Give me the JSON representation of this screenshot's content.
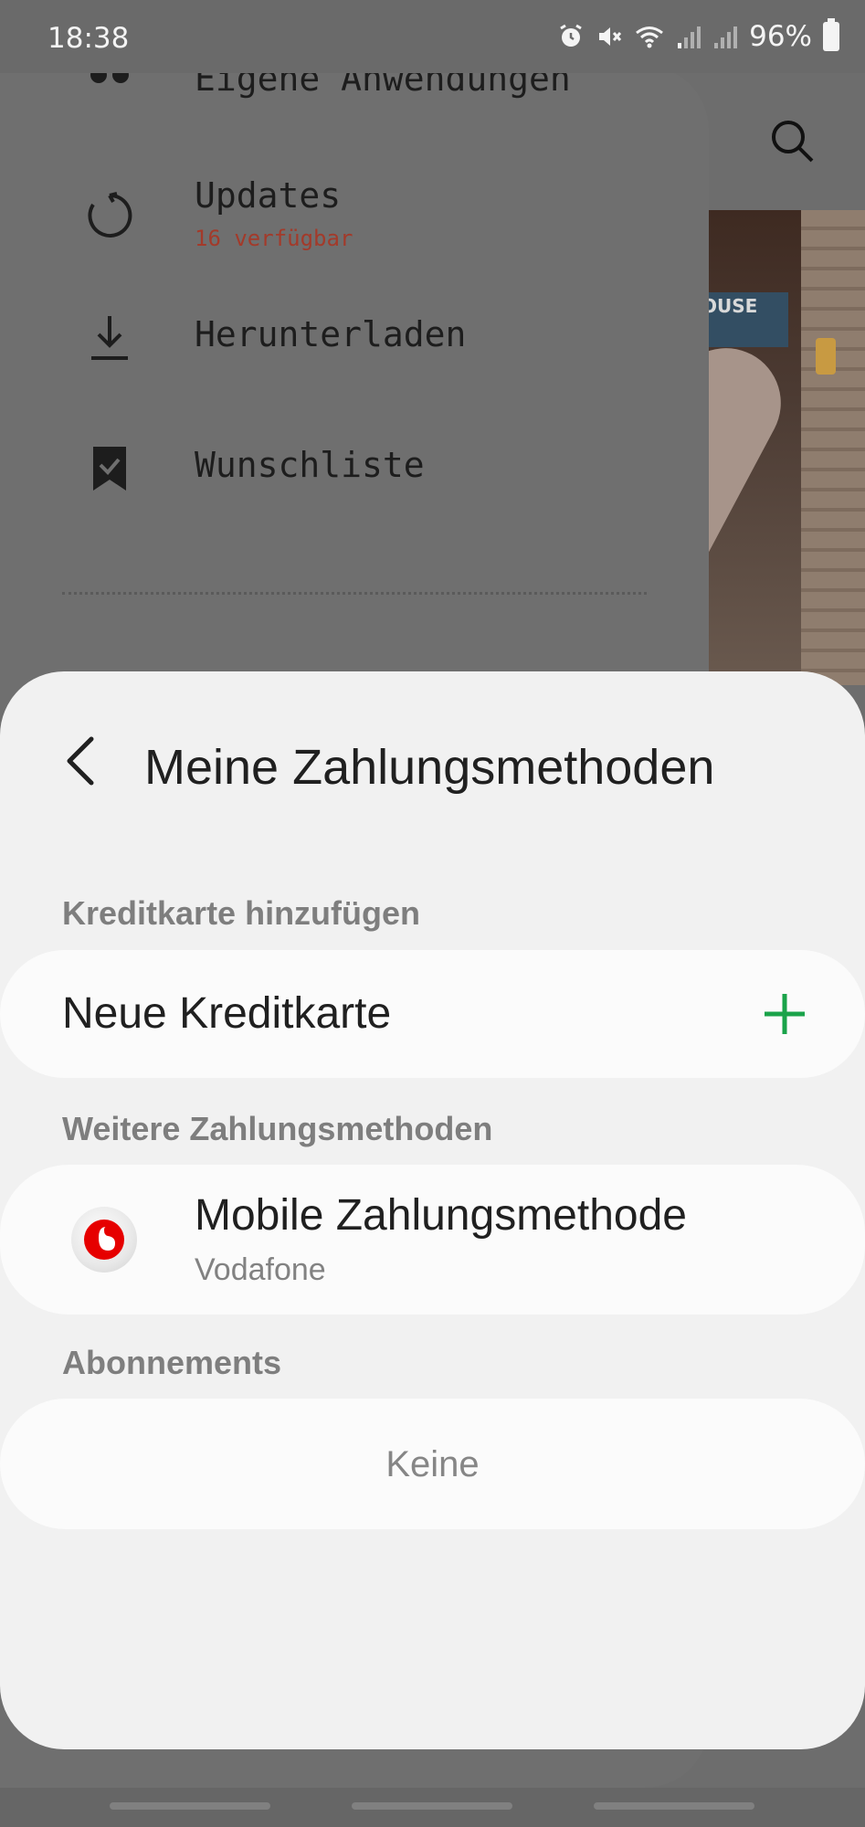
{
  "status_bar": {
    "time": "18:38",
    "battery": "96%",
    "icons": [
      "alarm-icon",
      "mute-icon",
      "wifi-icon",
      "signal-icon",
      "signal-icon",
      "battery-icon"
    ]
  },
  "drawer": {
    "items": [
      {
        "label": "Eigene Anwendungen",
        "icon": "apps-icon"
      },
      {
        "label": "Updates",
        "sub": "16 verfügbar",
        "icon": "refresh-icon"
      },
      {
        "label": "Herunterladen",
        "icon": "download-icon"
      },
      {
        "label": "Wunschliste",
        "icon": "bookmark-check-icon"
      }
    ]
  },
  "sheet": {
    "title": "Meine Zahlungsmethoden",
    "sections": {
      "credit_card": {
        "label": "Kreditkarte hinzufügen",
        "item": "Neue Kreditkarte"
      },
      "other": {
        "label": "Weitere Zahlungsmethoden",
        "item_title": "Mobile Zahlungsmethode",
        "item_sub": "Vodafone"
      },
      "subscriptions": {
        "label": "Abonnements",
        "empty": "Keine"
      }
    }
  },
  "colors": {
    "accent_green": "#1aa34a",
    "warning_red": "#a33a2a",
    "vodafone_red": "#e60000"
  },
  "banner_text": "OUSE"
}
